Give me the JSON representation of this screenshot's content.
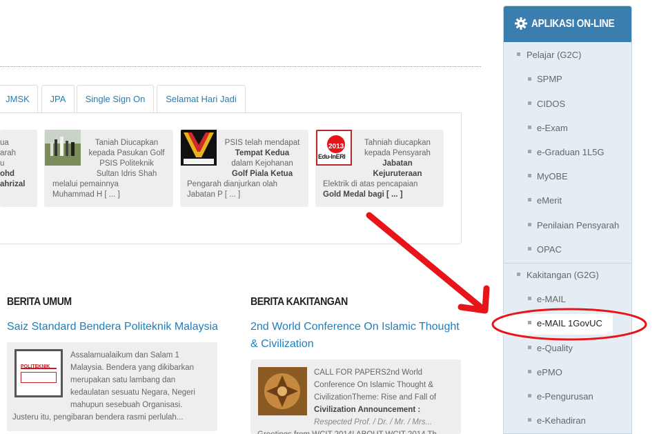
{
  "tabs": [
    "JMSK",
    "JPA",
    "Single Sign On",
    "Selamat Hari Jadi"
  ],
  "cards": [
    {
      "lines": [
        "ua",
        "arah",
        "u",
        "ohd",
        "ahrizal"
      ]
    },
    {
      "caption_top": [
        "Taniah Diucapkan",
        "kepada Pasukan Golf",
        "PSIS Politeknik",
        "Sultan Idris Shah"
      ],
      "caption_bottom": [
        "melalui pemainnya",
        "Muhammad H [ ... ]"
      ]
    },
    {
      "caption_top": [
        "PSIS telah mendapat",
        "Tempat Kedua",
        "dalam Kejohanan",
        "Golf Piala Ketua"
      ],
      "caption_bottom": [
        "Pengarah dianjurkan olah",
        "Jabatan P [ ... ]"
      ]
    },
    {
      "caption_top": [
        "Tahniah diucapkan",
        "kepada Pensyarah",
        "Jabatan",
        "Kejuruteraan"
      ],
      "caption_bottom": [
        "Elektrik di atas pencapaian",
        "Gold Medal bagi  [ ... ]"
      ],
      "thumb_text": [
        "2013",
        "Edu-InERI"
      ]
    }
  ],
  "berita_umum": {
    "heading": "BERITA UMUM",
    "title": "Saiz Standard Bendera Politeknik Malaysia",
    "excerpt_lines": [
      "Assalamualaikum dan Salam 1",
      "Malaysia. Bendera yang dikibarkan",
      "merupakan satu lambang dan",
      "kedaulatan sesuatu Negara, Negeri",
      "mahupun sesebuah Organisasi."
    ],
    "excerpt_last": "Justeru itu, pengibaran bendera rasmi perlulah...",
    "thumb_text": "POLITEKNIK"
  },
  "berita_kakitangan": {
    "heading": "BERITA KAKITANGAN",
    "title_lines": [
      "2nd World Conference On Islamic Thought",
      "& Civilization"
    ],
    "excerpt_lines": [
      "CALL FOR PAPERS2nd World",
      "Conference On Islamic Thought &",
      "CivilizationTheme: Rise and Fall of",
      "Civilization Announcement :"
    ],
    "excerpt_italic": "Respected Prof. / Dr. / Mr. / Mrs...",
    "excerpt_cut": "Greetings from WCIT 2014! ABOUT WCIT 2014 Th"
  },
  "sidebar": {
    "title": "APLIKASI ON-LINE",
    "group1": "Pelajar (G2C)",
    "group1_items": [
      "SPMP",
      "CIDOS",
      "e-Exam",
      "e-Graduan 1L5G",
      "MyOBE",
      "eMerit",
      "Penilaian Pensyarah",
      "OPAC"
    ],
    "group2": "Kakitangan (G2G)",
    "group2_items": [
      "e-MAIL",
      "e-MAIL 1GovUC",
      "e-Quality",
      "ePMO",
      "e-Pengurusan",
      "e-Kehadiran"
    ]
  },
  "colors": {
    "accent": "#1d7fba",
    "sidebar_header": "#3a7eb0",
    "annotation": "#e8141a"
  }
}
